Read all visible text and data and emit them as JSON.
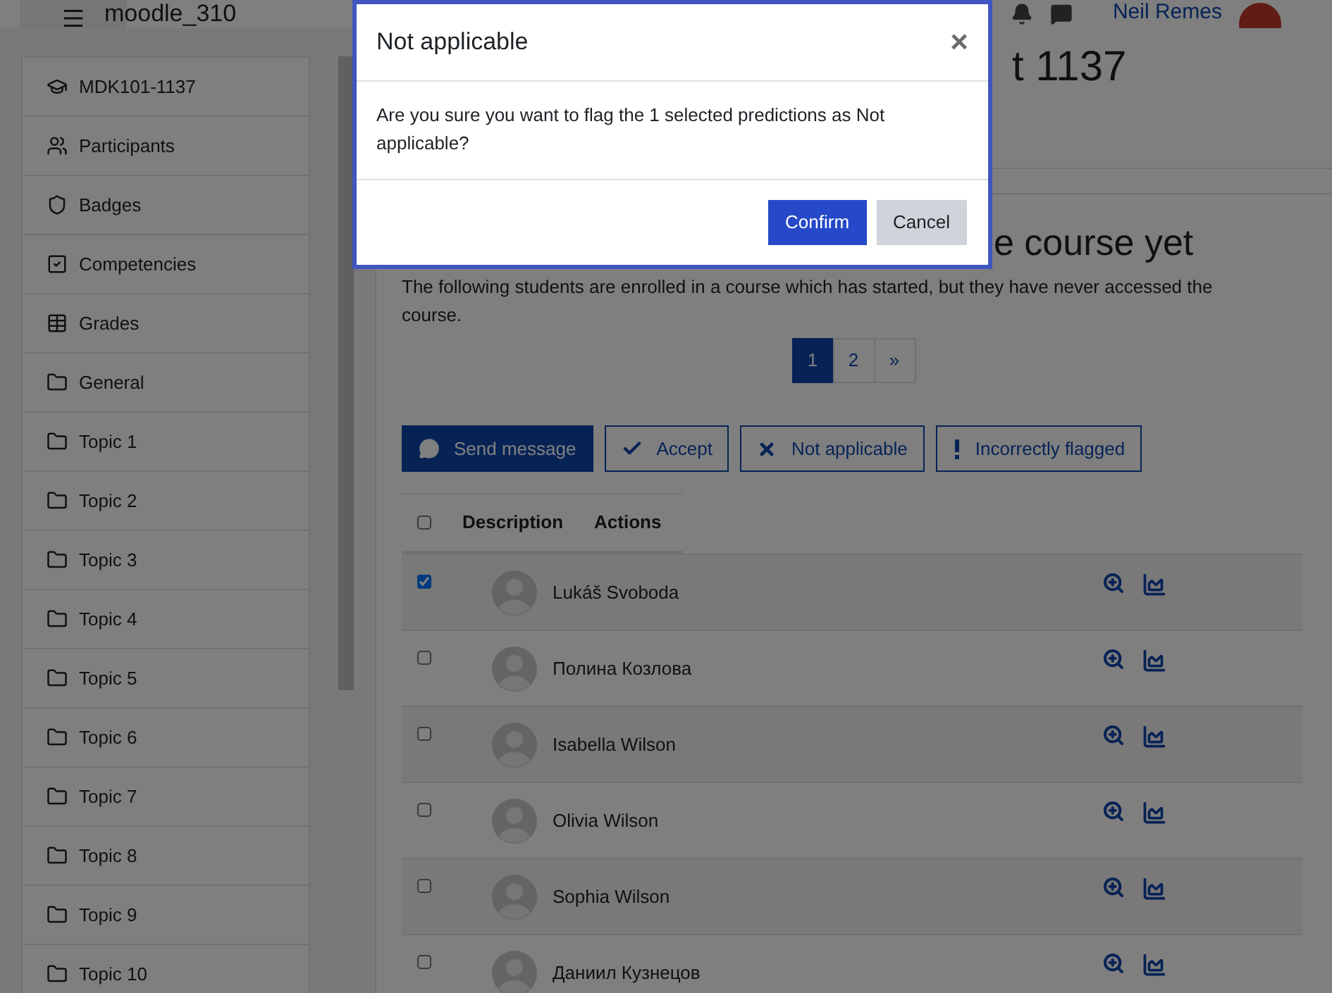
{
  "navbar": {
    "site_name": "moodle_310",
    "user_name": "Neil Remes"
  },
  "sidebar": {
    "items": [
      {
        "label": "MDK101-1137",
        "kind": "course"
      },
      {
        "label": "Participants",
        "kind": "participants"
      },
      {
        "label": "Badges",
        "kind": "badges"
      },
      {
        "label": "Competencies",
        "kind": "competencies"
      },
      {
        "label": "Grades",
        "kind": "grades"
      },
      {
        "label": "General",
        "kind": "section"
      },
      {
        "label": "Topic 1",
        "kind": "section"
      },
      {
        "label": "Topic 2",
        "kind": "section"
      },
      {
        "label": "Topic 3",
        "kind": "section"
      },
      {
        "label": "Topic 4",
        "kind": "section"
      },
      {
        "label": "Topic 5",
        "kind": "section"
      },
      {
        "label": "Topic 6",
        "kind": "section"
      },
      {
        "label": "Topic 7",
        "kind": "section"
      },
      {
        "label": "Topic 8",
        "kind": "section"
      },
      {
        "label": "Topic 9",
        "kind": "section"
      },
      {
        "label": "Topic 10",
        "kind": "section"
      }
    ]
  },
  "main": {
    "heading": "t 1137",
    "subheading": "e course yet",
    "description": "The following students are enrolled in a course which has started, but they have never accessed the course.",
    "pagination": [
      {
        "label": "1",
        "selected": true
      },
      {
        "label": "2",
        "selected": false
      },
      {
        "label": "»",
        "selected": false
      }
    ],
    "actions": [
      {
        "label": "Send message",
        "kind": "message",
        "primary": true
      },
      {
        "label": "Accept",
        "kind": "accept",
        "primary": false
      },
      {
        "label": "Not applicable",
        "kind": "not_applicable",
        "primary": false
      },
      {
        "label": "Incorrectly flagged",
        "kind": "flag",
        "primary": false
      }
    ],
    "table": {
      "select_all": false,
      "columns": [
        "Description",
        "Actions"
      ],
      "rows": [
        {
          "name": "Lukáš Svoboda",
          "selected": true
        },
        {
          "name": "Полина Козлова",
          "selected": false
        },
        {
          "name": "Isabella Wilson",
          "selected": false
        },
        {
          "name": "Olivia Wilson",
          "selected": false
        },
        {
          "name": "Sophia Wilson",
          "selected": false
        },
        {
          "name": "Даниил Кузнецов",
          "selected": false
        }
      ]
    }
  },
  "modal": {
    "title": "Not applicable",
    "close": "×",
    "message": "Are you sure you want to flag the 1 selected predictions as Not applicable?",
    "buttons": [
      {
        "label": "Confirm",
        "kind": "primary"
      },
      {
        "label": "Cancel",
        "kind": "secondary"
      }
    ]
  }
}
